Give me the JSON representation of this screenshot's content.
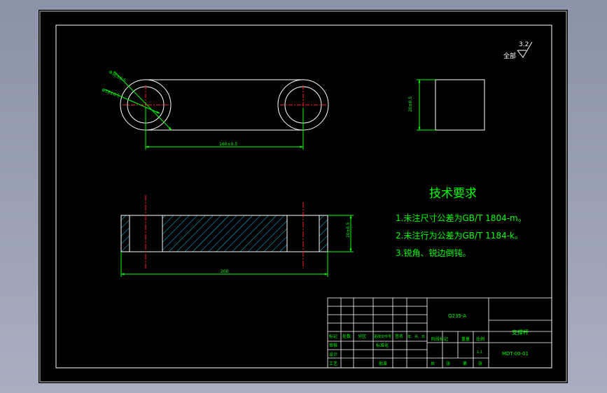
{
  "colors": {
    "background": "#000000",
    "outer_frame": "#c8c8c8",
    "border": "#ffffff",
    "dimension": "#00ff00",
    "center_line": "#ff2020",
    "hatch": "#00c8ff",
    "text": "#00ff00",
    "table_text": "#00ff00"
  },
  "roughness": {
    "prefix": "全部",
    "value": "3.2"
  },
  "dimensions": {
    "outer_diameter": "Φ36±0.5",
    "inner_diameter": "Φ18±0.5",
    "center_distance": "160±0.5",
    "side_height": "20±0.5",
    "section_height": "20±0.5",
    "overall_length": "200"
  },
  "tech_requirements": {
    "title": "技术要求",
    "items": [
      "1.未注尺寸公差为GB/T 1804-m。",
      "2.未注行为公差为GB/T 1184-k。",
      "3.锐角、锐边倒钝。"
    ]
  },
  "title_block": {
    "material": "Q235-A",
    "part_name": "支撑杆",
    "drawing_no": "MDT-00-01",
    "scale": "1:1",
    "rev_headers": [
      "标记",
      "处数",
      "分区",
      "更改文件号",
      "签名",
      "年、月、日"
    ],
    "roles": [
      "设计",
      "审核",
      "工艺"
    ],
    "standardize": "标准化",
    "approve": "批准",
    "stage_headers": [
      "阶段标记",
      "重量",
      "比例"
    ],
    "sheet_labels": [
      "共",
      "张",
      "第",
      "张"
    ]
  }
}
